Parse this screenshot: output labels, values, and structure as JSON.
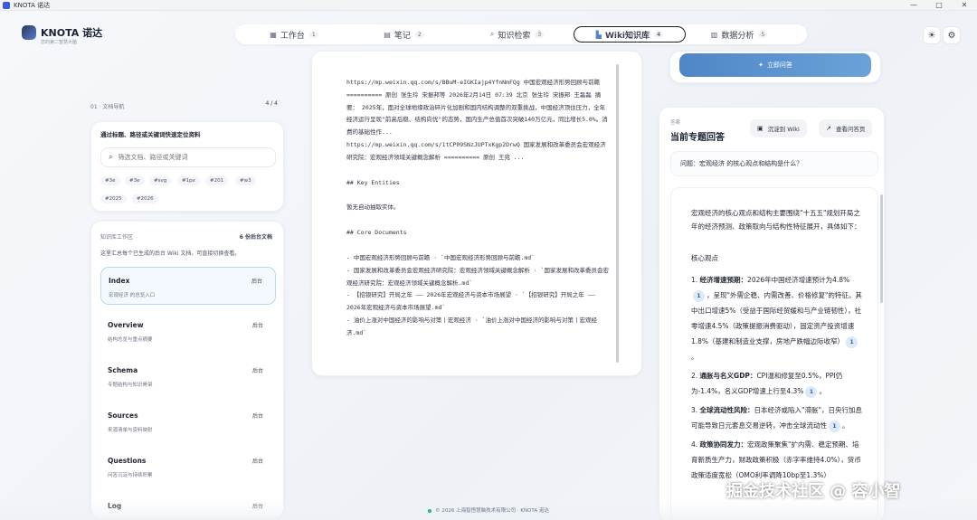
{
  "window": {
    "title": "KNOTA 诺达",
    "controls": [
      "—",
      "□",
      "✕"
    ]
  },
  "brand": {
    "name": "KNOTA 诺达",
    "sub": "您的第二智慧大脑"
  },
  "tabs": [
    {
      "icon": "workspace-icon",
      "glyph": "▦",
      "label": "工作台",
      "num": "1"
    },
    {
      "icon": "notes-icon",
      "glyph": "▤",
      "label": "笔记",
      "num": "2"
    },
    {
      "icon": "search-icon",
      "glyph": "⌕",
      "label": "知识检索",
      "num": "3"
    },
    {
      "icon": "wiki-icon",
      "glyph": "▙",
      "label": "Wiki知识库",
      "num": "4",
      "active": true
    },
    {
      "icon": "chart-icon",
      "glyph": "▥",
      "label": "数据分析",
      "num": "5"
    }
  ],
  "left": {
    "nav_label": "01 · 文档导航",
    "page": "4 / 4",
    "search_hint": "通过标题、路径或关键词快速定位资料",
    "search_placeholder": "筛选文档、路径或关键词",
    "chips": [
      "#3e",
      "#3e",
      "#svg",
      "#1px",
      "#201",
      "#w3",
      "#2025",
      "#2026"
    ],
    "workspace_title": "知识库工作区",
    "workspace_count": "6 份后台文档",
    "workspace_desc": "这里汇总每个已生成的后台 Wiki 文档，可直接切换查看。",
    "docs": [
      {
        "name": "Index",
        "desc": "宏观经济 的总览入口",
        "tag": "后台"
      },
      {
        "name": "Overview",
        "desc": "结构总览与重点摘要",
        "tag": "后台"
      },
      {
        "name": "Schema",
        "desc": "专题结构与知识骨架",
        "tag": "后台"
      },
      {
        "name": "Sources",
        "desc": "来源清单与资料映射",
        "tag": "后台"
      },
      {
        "name": "Questions",
        "desc": "问答沉淀与持续积累",
        "tag": "后台"
      },
      {
        "name": "Log",
        "desc": "",
        "tag": "后台"
      }
    ]
  },
  "middle": {
    "lines_top": [
      "https://mp.weixin.qq.com/s/BBuM-eIGKIajp4YfnNmFQg 中国宏观经济形势回顾与前瞻 ========== 原创 张生玲 宋振邦等 2026年2月14日 07:39 北京 张生玲 宋振邦 王磊磊 摘 要： 2025年，面对全球地缘政治碎片化加剧和国内结构调整的双重挑战，中国经济顶住压力，全年经济运行呈现\"前高后稳、结构向优\"的态势，国内生产总值首次突破140万亿元，同比增长5.0%。消费的基础性作...",
      "https://mp.weixin.qq.com/s/1tCP09SNzJUPTxKgp2DrwQ 国家发展和改革委员会宏观经济研究院：宏观经济领域关键概念解析 ========== 原创 王宛 ..."
    ],
    "h_entities": "## Key Entities",
    "entities_empty": "暂无自动抽取实体。",
    "h_core": "## Core Documents",
    "core_docs": [
      "- 中国宏观经济形势回顾与前瞻 · `中国宏观经济形势回顾与前瞻.md`",
      "- 国家发展和改革委员会宏观经济研究院：宏观经济领域关键概念解析 · `国家发展和改革委员会宏观经济研究院：宏观经济领域关键概念解析.md`",
      "- 【招银研究】开局之年 —— 2026年宏观经济与资本市场展望 · `【招银研究】开局之年 —— 2026年宏观经济与资本市场展望.md`",
      "- 油价上涨对中国经济的影响与对策丨宏观经济 · `油价上涨对中国经济的影响与对策丨宏观经济.md`"
    ]
  },
  "right": {
    "generate_label": "立即问答",
    "kicker": "答案",
    "title": "当前专题回答",
    "save_label": "沉淀到 Wiki",
    "view_label": "查看问答页",
    "question": "问题：宏观经济 的核心观点和结构是什么？",
    "intro": "宏观经济的核心观点和结构主要围绕\"十五五\"规划开局之年的经济预测、政策取向与结构性特征展开，具体如下：",
    "section": "核心观点",
    "points": [
      {
        "head": "经济增速预期：",
        "pre": "2026年中国经济增速预计为4.8%",
        "cite1": "1",
        "mid": "，呈现\"外需企稳、内需改善、价格修复\"的特征。其中出口增速5%（受益于国际经贸缓和与产业链韧性），社零增速4.5%（政策提振消费驱动），固定资产投资增速1.8%（基建和制造业支撑，房地产跌幅边际收窄）",
        "cite2": "1",
        "post": "。"
      },
      {
        "head": "通胀与名义GDP：",
        "pre": "CPI温和修复至0.5%，PPI仍为-1.4%，名义GDP增速上行至4.3%",
        "cite1": "1",
        "mid": "",
        "cite2": "",
        "post": "。"
      },
      {
        "head": "全球流动性风险：",
        "pre": "日本经济或陷入\"滞胀\"，日央行加息可能导致日元套息交易逆转，冲击全球流动性",
        "cite1": "1",
        "mid": "",
        "cite2": "",
        "post": "。"
      },
      {
        "head": "政策协同发力：",
        "pre": "宏观政策聚焦\"扩内需、稳定预期、培育新质生产力，财政政策积极（赤字率维持4.0%），货币政策适度宽松（OMO利率调降10bp至1.3%）",
        "cite1": "",
        "mid": "",
        "cite2": "",
        "post": ""
      }
    ]
  },
  "footer": "© 2026 上海智悟慧脑技术有限公司 · KNOTA 诺达",
  "watermark": "掘金技术社区 @ 容小智",
  "colors": {
    "accent": "#5b8fd0",
    "status": "#2fb37a"
  }
}
